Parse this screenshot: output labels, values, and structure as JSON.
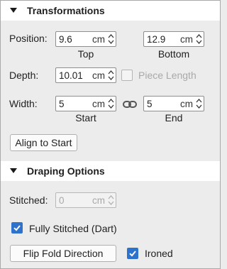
{
  "transformations": {
    "title": "Transformations",
    "position_label": "Position:",
    "position_top": {
      "value": "9.6",
      "unit": "cm",
      "caption": "Top"
    },
    "position_bottom": {
      "value": "12.9",
      "unit": "cm",
      "caption": "Bottom"
    },
    "depth_label": "Depth:",
    "depth": {
      "value": "10.01",
      "unit": "cm"
    },
    "piece_length_label": "Piece Length",
    "piece_length_checked": false,
    "width_label": "Width:",
    "width_start": {
      "value": "5",
      "unit": "cm",
      "caption": "Start"
    },
    "width_end": {
      "value": "5",
      "unit": "cm",
      "caption": "End"
    },
    "link_icon": "chain-link-icon",
    "align_button": "Align to Start"
  },
  "draping": {
    "title": "Draping Options",
    "stitched_label": "Stitched:",
    "stitched": {
      "value": "0",
      "unit": "cm"
    },
    "fully_stitched_label": "Fully Stitched (Dart)",
    "fully_stitched_checked": true,
    "flip_button": "Flip Fold Direction",
    "ironed_label": "Ironed",
    "ironed_checked": true
  },
  "colors": {
    "accent": "#2d73cc",
    "header_bg": "#ffffff",
    "panel_bg": "#ececec"
  }
}
